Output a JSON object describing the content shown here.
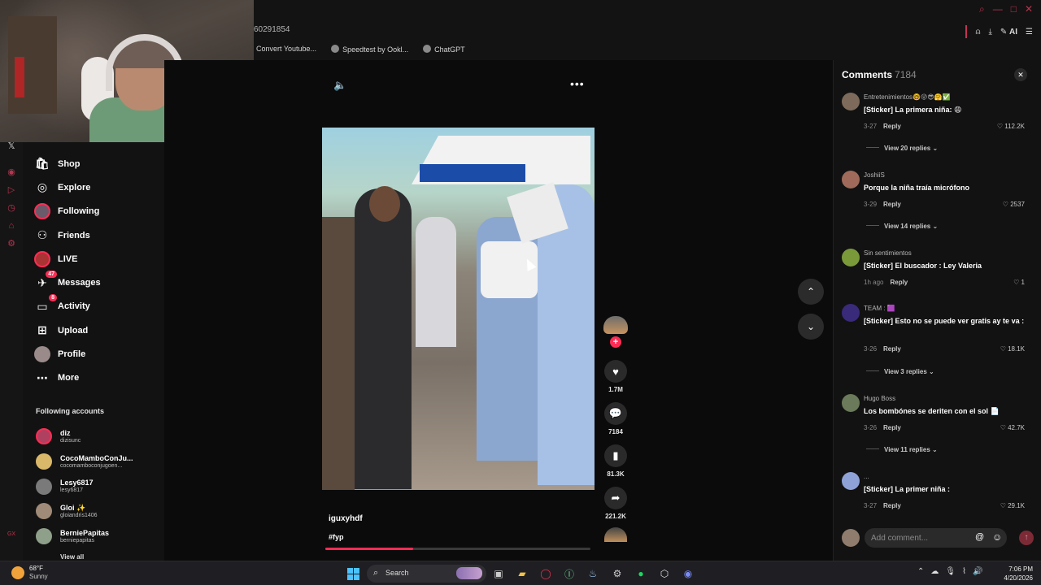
{
  "browser": {
    "url_fragment": "60291854",
    "bookmarks": [
      "Convert Youtube...",
      "Speedtest by Ookl...",
      "ChatGPT"
    ],
    "ai_label": "AI"
  },
  "sidebar": {
    "nav": [
      {
        "label": "Shop",
        "icon": "shop-icon"
      },
      {
        "label": "Explore",
        "icon": "compass-icon"
      },
      {
        "label": "Following",
        "icon": "following-avatar"
      },
      {
        "label": "Friends",
        "icon": "friends-icon"
      },
      {
        "label": "LIVE",
        "icon": "live-icon"
      },
      {
        "label": "Messages",
        "icon": "messages-icon",
        "badge": "47"
      },
      {
        "label": "Activity",
        "icon": "activity-icon",
        "badge": "8"
      },
      {
        "label": "Upload",
        "icon": "upload-icon"
      },
      {
        "label": "Profile",
        "icon": "profile-avatar"
      },
      {
        "label": "More",
        "icon": "more-icon"
      }
    ],
    "following_title": "Following accounts",
    "following": [
      {
        "name": "diz",
        "handle": "dizisunc"
      },
      {
        "name": "CocoMamboConJu...",
        "handle": "cocomamboconjugoen..."
      },
      {
        "name": "Lesy6817",
        "handle": "lesy6817"
      },
      {
        "name": "Gloi ✨",
        "handle": "gloiandris1406"
      },
      {
        "name": "BerniePapitas",
        "handle": "berniepapitas"
      }
    ],
    "view_all": "View all"
  },
  "video": {
    "author": "iguxyhdf",
    "caption": "#fyp",
    "progress": 0.33,
    "likes": "1.7M",
    "comments": "7184",
    "saves": "81.3K",
    "shares": "221.2K"
  },
  "comments_panel": {
    "title": "Comments",
    "count": "7184",
    "placeholder": "Add comment...",
    "items": [
      {
        "user": "Entretenimientos🤓😜😎🤗✅",
        "text": "[Sticker] La primera niña: 😩",
        "date": "3-27",
        "reply": "Reply",
        "likes": "112.2K",
        "view_replies": "View 20 replies"
      },
      {
        "user": "JoshiiS",
        "text": "Porque la niña traía micrófono",
        "date": "3-29",
        "reply": "Reply",
        "likes": "2537",
        "view_replies": "View 14 replies"
      },
      {
        "user": "Sin sentimientos",
        "text": "[Sticker] El buscador : Ley Valeria",
        "date": "1h ago",
        "reply": "Reply",
        "likes": "1",
        "view_replies": ""
      },
      {
        "user": "TEAM : 🟪",
        "text": "[Sticker] Esto no se puede ver gratis ay te va :",
        "date": "3-26",
        "reply": "Reply",
        "likes": "18.1K",
        "view_replies": "View 3 replies"
      },
      {
        "user": "Hugo Boss",
        "text": "Los bombónes se deriten con el sol 📄",
        "date": "3-26",
        "reply": "Reply",
        "likes": "42.7K",
        "view_replies": "View 11 replies"
      },
      {
        "user": "...",
        "text": "[Sticker] La primer niña :",
        "date": "3-27",
        "reply": "Reply",
        "likes": "29.1K",
        "view_replies": ""
      }
    ]
  },
  "taskbar": {
    "temperature": "68°F",
    "weather": "Sunny",
    "search": "Search",
    "time": "7:06 PM",
    "date": "4/20/2026"
  }
}
